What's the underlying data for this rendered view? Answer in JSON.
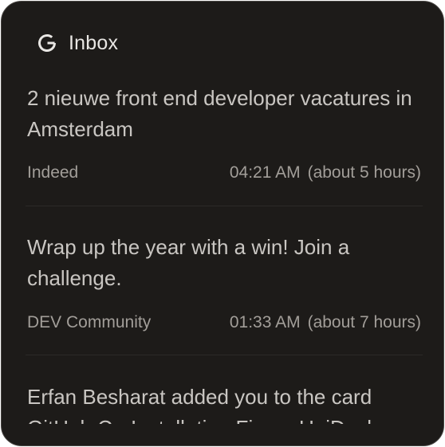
{
  "widget": {
    "title": "Inbox",
    "icon": "google-g-icon"
  },
  "emails": [
    {
      "subject": "2 nieuwe front end developer vacatures in Amsterdam",
      "sender": "Indeed",
      "time": "04:21 AM",
      "relative": "(about 5 hours)"
    },
    {
      "subject": "Wrap up the year with a win! Join a challenge.",
      "sender": "DEV Community",
      "time": "01:33 AM",
      "relative": "(about 7 hours)"
    },
    {
      "subject": "Erfan Besharat added you to the card GitHub Co-Installation Figma UniDeck"
    }
  ],
  "colors": {
    "background": "#1d1b19",
    "subject_text": "#c9c6c2",
    "meta_text": "#a29e99",
    "divider": "#2c2a27"
  }
}
